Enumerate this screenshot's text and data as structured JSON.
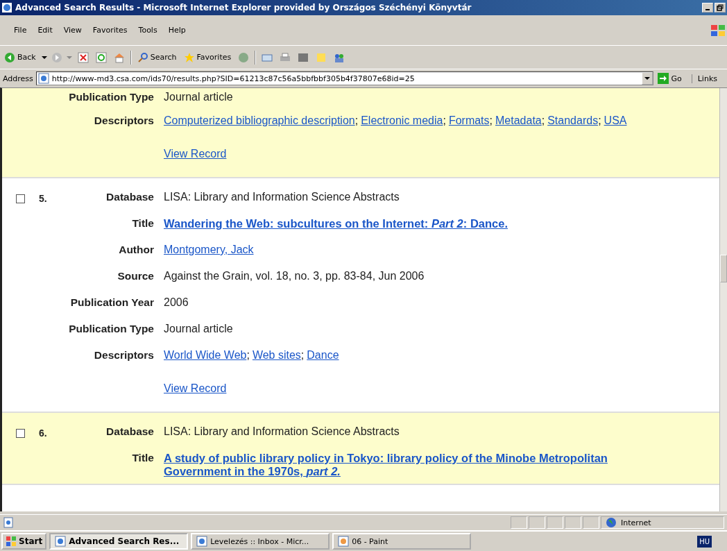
{
  "window": {
    "title": "Advanced Search Results - Microsoft Internet Explorer provided by Országos Széchényi Könyvtár"
  },
  "menu": [
    "File",
    "Edit",
    "View",
    "Favorites",
    "Tools",
    "Help"
  ],
  "toolbar": {
    "back": "Back",
    "search": "Search",
    "favorites": "Favorites"
  },
  "address": {
    "label": "Address",
    "url": "http://www-md3.csa.com/ids70/results.php?SID=61213c87c56a5bbfbbf305b4f37807e68id=25",
    "go": "Go",
    "links": "Links"
  },
  "records": [
    {
      "highlighted": true,
      "fields": [
        {
          "kind": "text",
          "label": "Publication Type",
          "value": "Journal article"
        },
        {
          "kind": "links",
          "label": "Descriptors",
          "separator": ";",
          "links": [
            "Computerized bibliographic description",
            "Electronic media",
            "Formats",
            "Metadata",
            "Standards",
            "USA"
          ]
        }
      ],
      "view": "View Record"
    },
    {
      "highlighted": false,
      "number": "5.",
      "checked": false,
      "fields": [
        {
          "kind": "text",
          "label": "Database",
          "value": "LISA: Library and Information Science Abstracts"
        },
        {
          "kind": "title",
          "label": "Title",
          "value": "Wandering the Web: subcultures on the Internet: *Part 2*: Dance."
        },
        {
          "kind": "links",
          "label": "Author",
          "links": [
            "Montgomery, Jack"
          ]
        },
        {
          "kind": "text",
          "label": "Source",
          "value": "Against the Grain, vol. 18, no. 3, pp. 83-84, Jun 2006"
        },
        {
          "kind": "text",
          "label": "Publication Year",
          "value": "2006"
        },
        {
          "kind": "text",
          "label": "Publication Type",
          "value": "Journal article"
        },
        {
          "kind": "links",
          "label": "Descriptors",
          "separator": ";",
          "links": [
            "World Wide Web",
            "Web sites",
            "Dance"
          ]
        }
      ],
      "view": "View Record"
    },
    {
      "highlighted": true,
      "number": "6.",
      "checked": false,
      "fields": [
        {
          "kind": "text",
          "label": "Database",
          "value": "LISA: Library and Information Science Abstracts"
        },
        {
          "kind": "title",
          "label": "Title",
          "value": "A study of public library policy in Tokyo: library policy of the Minobe Metropolitan Government in the 1970s, *part 2.*"
        }
      ]
    }
  ],
  "status_bar": {
    "zone": "Internet"
  },
  "taskbar": {
    "start": "Start",
    "tasks": [
      {
        "label": "Advanced Search Res...",
        "selected": true
      },
      {
        "label": "Levelezés :: Inbox - Micr...",
        "selected": false
      },
      {
        "label": "06 - Paint",
        "selected": false
      }
    ],
    "language": "HU"
  }
}
